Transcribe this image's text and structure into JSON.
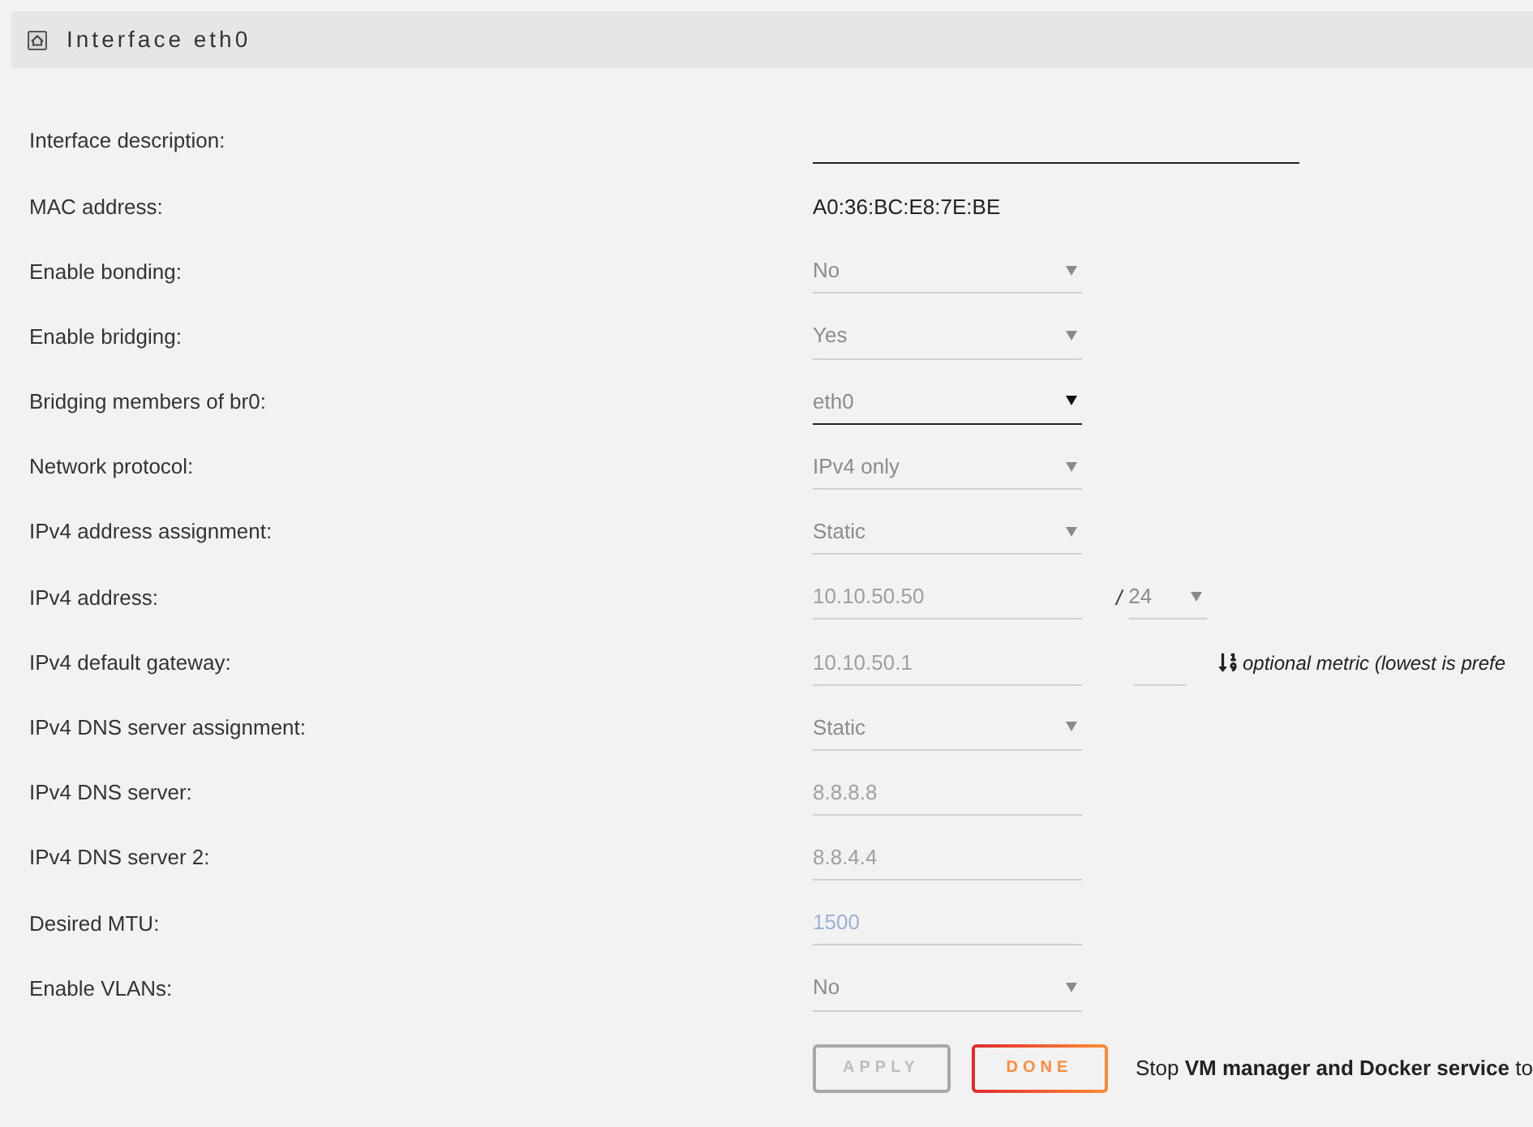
{
  "header": {
    "title": "Interface eth0"
  },
  "rows": [
    {
      "label": "Interface description:",
      "kind": "text-wide",
      "disabled": false
    },
    {
      "label": "MAC address:",
      "kind": "static",
      "value": "A0:36:BC:E8:7E:BE"
    },
    {
      "label": "Enable bonding:",
      "kind": "select",
      "value": "No",
      "disabled": true
    },
    {
      "label": "Enable bridging:",
      "kind": "select",
      "value": "Yes",
      "disabled": true
    },
    {
      "label": "Bridging members of br0:",
      "kind": "select",
      "value": "eth0",
      "disabled": false
    },
    {
      "label": "Network protocol:",
      "kind": "select",
      "value": "IPv4 only",
      "disabled": true
    },
    {
      "label": "IPv4 address assignment:",
      "kind": "select",
      "value": "Static",
      "disabled": true
    },
    {
      "label": "IPv4 address:",
      "kind": "input",
      "value": "10.10.50.50",
      "disabled": true,
      "prefix_length": {
        "separator": "/",
        "value": "24",
        "disabled": true
      }
    },
    {
      "label": "IPv4 default gateway:",
      "kind": "input",
      "value": "10.10.50.1",
      "disabled": true,
      "metric_hint": "optional metric (lowest is prefe"
    },
    {
      "label": "IPv4 DNS server assignment:",
      "kind": "select",
      "value": "Static",
      "disabled": true
    },
    {
      "label": "IPv4 DNS server:",
      "kind": "input",
      "value": "8.8.8.8",
      "disabled": true
    },
    {
      "label": "IPv4 DNS server 2:",
      "kind": "input",
      "value": "8.8.4.4",
      "disabled": true
    },
    {
      "label": "Desired MTU:",
      "kind": "input",
      "placeholder": "1500",
      "disabled": true
    },
    {
      "label": "Enable VLANs:",
      "kind": "select",
      "value": "No",
      "disabled": true
    }
  ],
  "buttons": [
    {
      "label": "APPLY",
      "disabled": true
    },
    {
      "label": "DONE",
      "disabled": false
    }
  ],
  "note": "Stop **VM manager and Docker service** to"
}
